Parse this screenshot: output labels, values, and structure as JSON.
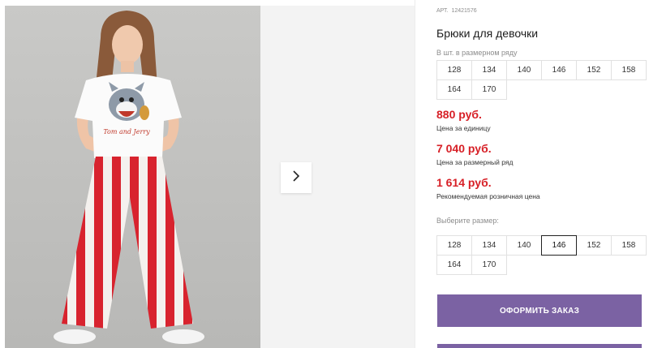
{
  "product": {
    "article_label": "АРТ.",
    "article_number": "12421576",
    "title": "Брюки для девочки"
  },
  "size_row": {
    "label": "В шт. в размерном ряду",
    "sizes": [
      "128",
      "134",
      "140",
      "146",
      "152",
      "158",
      "164",
      "170"
    ]
  },
  "prices": [
    {
      "value": "880 руб.",
      "note": "Цена за единицу"
    },
    {
      "value": "7 040 руб.",
      "note": "Цена за размерный ряд"
    },
    {
      "value": "1 614 руб.",
      "note": "Рекомендуемая розничная цена"
    }
  ],
  "size_select": {
    "label": "Выберите размер:",
    "sizes": [
      "128",
      "134",
      "140",
      "146",
      "152",
      "158",
      "164",
      "170"
    ],
    "selected": "146"
  },
  "actions": {
    "order_label": "ОФОРМИТЬ ЗАКАЗ"
  },
  "gallery": {
    "next_icon": "chevron-right-icon",
    "shirt_print_text": "Tom and Jerry"
  },
  "colors": {
    "price_red": "#d71f26",
    "button_purple": "#7b62a3",
    "stripe_red": "#d8232e"
  }
}
